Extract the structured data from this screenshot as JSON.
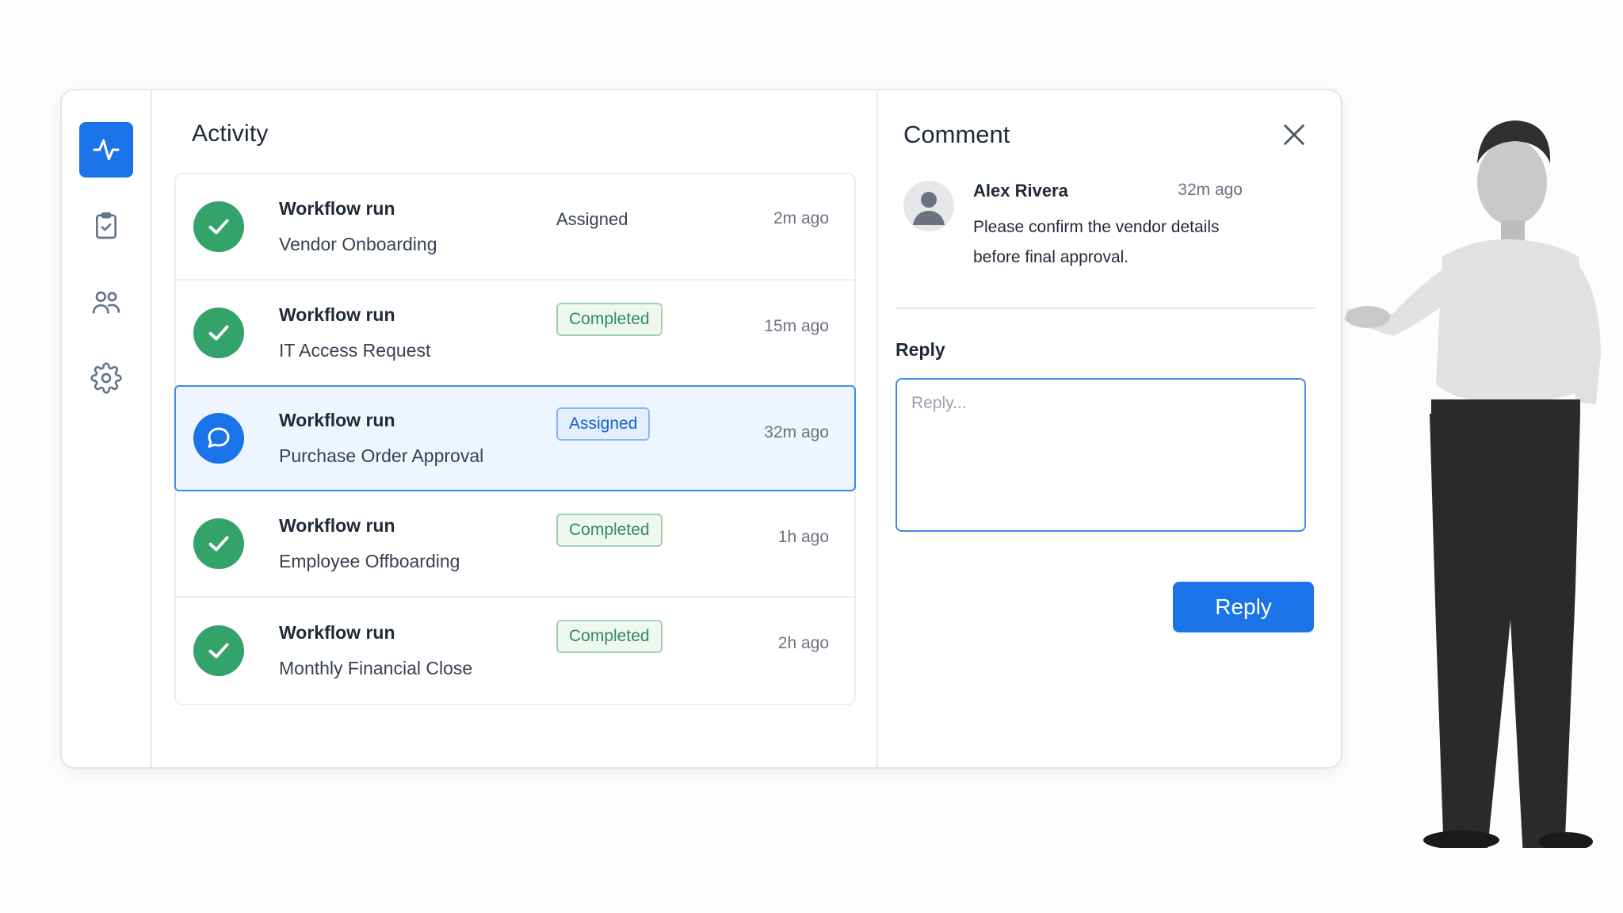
{
  "sidebar": {
    "items": [
      {
        "name": "activity",
        "icon": "activity-pulse-icon",
        "active": true
      },
      {
        "name": "tasks",
        "icon": "clipboard-check-icon",
        "active": false
      },
      {
        "name": "users",
        "icon": "users-icon",
        "active": false
      },
      {
        "name": "settings",
        "icon": "gear-icon",
        "active": false
      }
    ]
  },
  "activity": {
    "title": "Activity",
    "rows": [
      {
        "title": "Workflow run",
        "subtitle": "Vendor Onboarding",
        "status": "Assigned",
        "status_style": "plain",
        "time": "2m ago",
        "icon": "check-circle-icon",
        "selected": false
      },
      {
        "title": "Workflow run",
        "subtitle": "IT Access Request",
        "status": "Completed",
        "status_style": "completed",
        "time": "15m ago",
        "icon": "check-circle-icon",
        "selected": false
      },
      {
        "title": "Workflow run",
        "subtitle": "Purchase Order Approval",
        "status": "Assigned",
        "status_style": "assigned",
        "time": "32m ago",
        "icon": "comment-icon",
        "selected": true
      },
      {
        "title": "Workflow run",
        "subtitle": "Employee Offboarding",
        "status": "Completed",
        "status_style": "completed",
        "time": "1h ago",
        "icon": "check-circle-icon",
        "selected": false
      },
      {
        "title": "Workflow run",
        "subtitle": "Monthly Financial Close",
        "status": "Completed",
        "status_style": "completed",
        "time": "2h ago",
        "icon": "check-circle-icon",
        "selected": false
      }
    ]
  },
  "comment": {
    "title": "Comment",
    "author": "Alex Rivera",
    "time": "32m ago",
    "text": "Please confirm the vendor details before final approval.",
    "reply_label": "Reply",
    "reply_placeholder": "Reply...",
    "reply_value": "",
    "reply_button": "Reply"
  },
  "colors": {
    "accent": "#1a73e8",
    "success": "#34a36a",
    "selected_row_bg": "#eef5fe"
  }
}
